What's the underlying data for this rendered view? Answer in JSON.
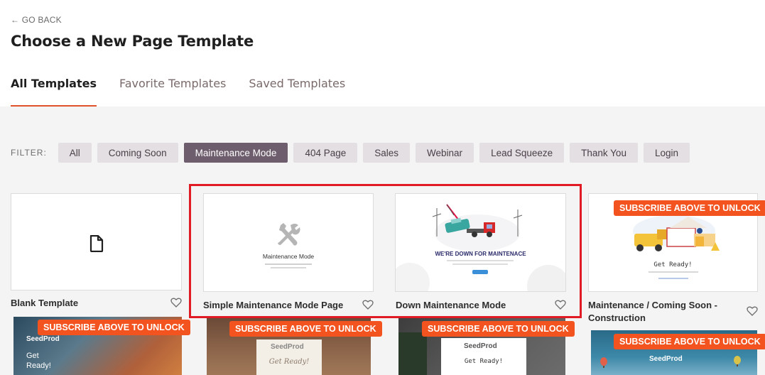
{
  "header": {
    "back_label": "← GO BACK",
    "title": "Choose a New Page Template",
    "tabs": [
      {
        "label": "All Templates",
        "active": true
      },
      {
        "label": "Favorite Templates",
        "active": false
      },
      {
        "label": "Saved Templates",
        "active": false
      }
    ]
  },
  "filter": {
    "label": "FILTER:",
    "options": [
      {
        "label": "All",
        "active": false
      },
      {
        "label": "Coming Soon",
        "active": false
      },
      {
        "label": "Maintenance Mode",
        "active": true
      },
      {
        "label": "404 Page",
        "active": false
      },
      {
        "label": "Sales",
        "active": false
      },
      {
        "label": "Webinar",
        "active": false
      },
      {
        "label": "Lead Squeeze",
        "active": false
      },
      {
        "label": "Thank You",
        "active": false
      },
      {
        "label": "Login",
        "active": false
      }
    ]
  },
  "templates": [
    {
      "title": "Blank Template",
      "icon": "document-icon"
    },
    {
      "title": "Simple Maintenance Mode Page",
      "preview_heading": "Maintenance Mode",
      "icon": "tools-icon"
    },
    {
      "title": "Down Maintenance Mode",
      "preview_heading": "WE'RE DOWN FOR MAINTENACE"
    },
    {
      "title": "Maintenance / Coming Soon - Construction",
      "preview_heading": "Get Ready!"
    }
  ],
  "bottom_row": [
    {
      "brand": "SeedProd",
      "heading": "Get Ready!"
    },
    {
      "brand": "SeedProd",
      "heading": "Get Ready!"
    },
    {
      "brand": "SeedProd",
      "heading": "Get Ready!"
    },
    {
      "brand": "SeedProd"
    }
  ],
  "unlock_label": "SUBSCRIBE ABOVE TO UNLOCK",
  "colors": {
    "accent": "#f2531f",
    "active_chip": "#6e5d6c",
    "highlight": "#e01b24",
    "tab_underline": "#e0522a"
  }
}
